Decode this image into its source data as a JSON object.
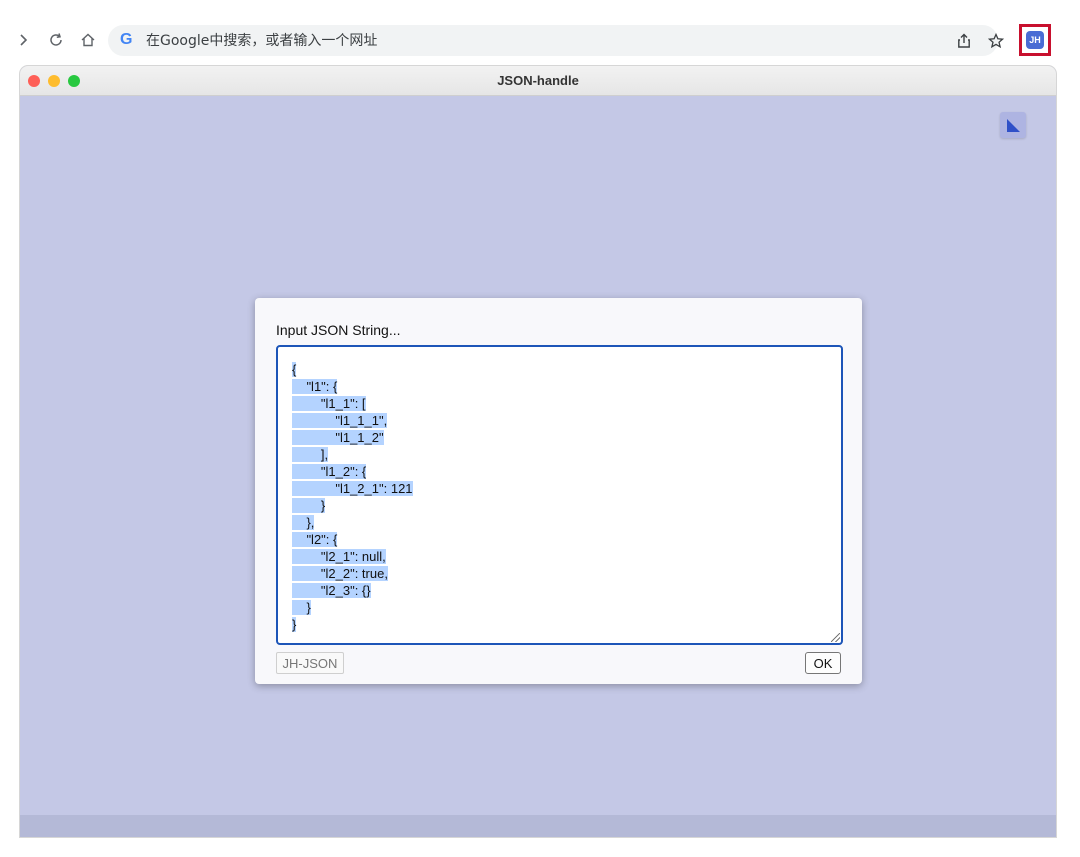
{
  "browser": {
    "omnibox_placeholder": "在Google中搜索，或者输入一个网址",
    "google_logo_text": "G",
    "icons": {
      "forward": "forward-arrow-icon",
      "reload": "reload-icon",
      "home": "home-icon",
      "share": "share-icon",
      "bookmark": "star-icon",
      "extension": "jh-extension-icon"
    },
    "extension_label": "JH",
    "highlight_color": "#c8102e"
  },
  "window": {
    "title": "JSON-handle",
    "background_color": "#c4c8e6"
  },
  "dialog": {
    "label": "Input JSON String...",
    "json_lines": [
      "{",
      "    \"l1\": {",
      "        \"l1_1\": [",
      "            \"l1_1_1\",",
      "            \"l1_1_2\"",
      "        ],",
      "        \"l1_2\": {",
      "            \"l1_2_1\": 121",
      "        }",
      "    },",
      "    \"l2\": {",
      "        \"l2_1\": null,",
      "        \"l2_2\": true,",
      "        \"l2_3\": {}",
      "    }",
      "}"
    ],
    "jh_button_label": "JH-JSON",
    "ok_button_label": "OK",
    "selection_color": "#b4d3ff",
    "focus_border_color": "#1d55b8"
  }
}
